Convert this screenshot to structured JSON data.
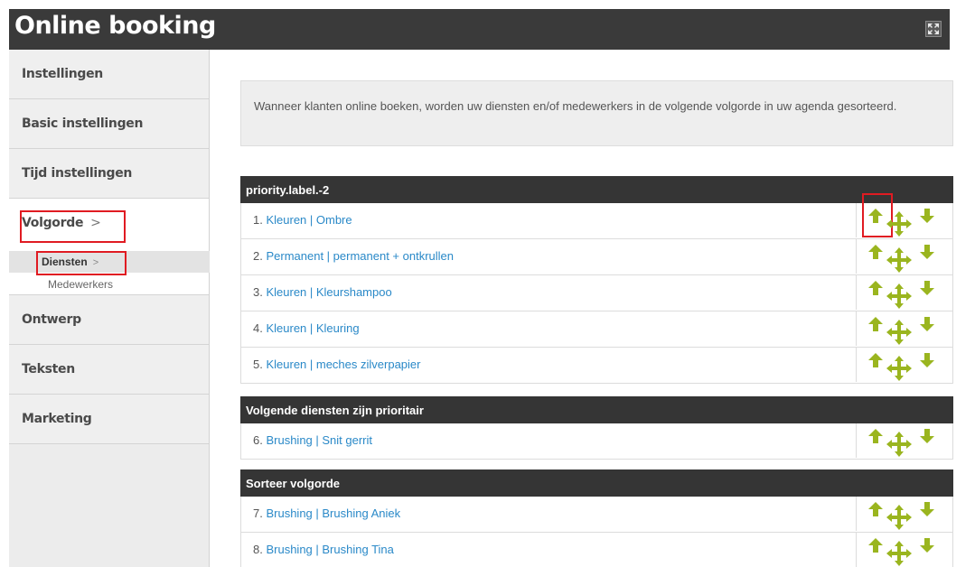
{
  "window": {
    "title": "Online booking"
  },
  "sidebar": {
    "items": [
      {
        "label": "Instellingen"
      },
      {
        "label": "Basic instellingen"
      },
      {
        "label": "Tijd instellingen"
      },
      {
        "label": "Volgorde",
        "chevron": ">"
      },
      {
        "label": "Ontwerp"
      },
      {
        "label": "Teksten"
      },
      {
        "label": "Marketing"
      }
    ],
    "subitems": [
      {
        "label": "Diensten",
        "chevron": ">"
      },
      {
        "label": "Medewerkers"
      }
    ]
  },
  "info_text": "Wanneer klanten online boeken, worden uw diensten en/of medewerkers in de volgende volgorde in uw agenda gesorteerd.",
  "groups": [
    {
      "title": "priority.label.-2",
      "rows": [
        {
          "num": "1.",
          "text": "Kleuren | Ombre"
        },
        {
          "num": "2.",
          "text": "Permanent | permanent + ontkrullen"
        },
        {
          "num": "3.",
          "text": "Kleuren | Kleurshampoo"
        },
        {
          "num": "4.",
          "text": "Kleuren | Kleuring"
        },
        {
          "num": "5.",
          "text": "Kleuren | meches zilverpapier"
        }
      ]
    },
    {
      "title": "Volgende diensten zijn prioritair",
      "rows": [
        {
          "num": "6.",
          "text": "Brushing | Snit gerrit"
        }
      ]
    },
    {
      "title": "Sorteer volgorde",
      "rows": [
        {
          "num": "7.",
          "text": "Brushing | Brushing Aniek"
        },
        {
          "num": "8.",
          "text": "Brushing | Brushing Tina"
        }
      ]
    }
  ],
  "icons": {
    "up": "arrow-up-icon",
    "move": "move-icon",
    "down": "arrow-down-icon",
    "fullscreen": "fullscreen-icon"
  },
  "colors": {
    "header_bg": "#3a3a3a",
    "link": "#2a89c8",
    "action_green": "#9ab51f",
    "highlight_red": "#e01b22"
  }
}
